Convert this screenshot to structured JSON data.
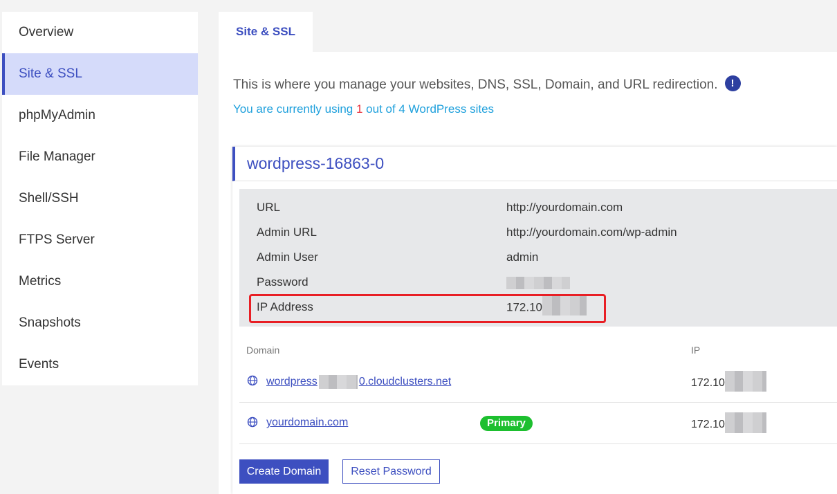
{
  "sidebar": {
    "items": [
      {
        "label": "Overview"
      },
      {
        "label": "Site & SSL"
      },
      {
        "label": "phpMyAdmin"
      },
      {
        "label": "File Manager"
      },
      {
        "label": "Shell/SSH"
      },
      {
        "label": "FTPS Server"
      },
      {
        "label": "Metrics"
      },
      {
        "label": "Snapshots"
      },
      {
        "label": "Events"
      }
    ],
    "active_index": 1
  },
  "tabs": [
    {
      "label": "Site & SSL"
    }
  ],
  "intro": {
    "description": "This is where you manage your websites, DNS, SSL, Domain, and URL redirection.",
    "info_icon": "!",
    "usage_prefix": "You are currently using ",
    "usage_count": "1",
    "usage_suffix": " out of 4 WordPress sites"
  },
  "site": {
    "name": "wordpress-16863-0",
    "details": [
      {
        "key": "URL",
        "value": "http://yourdomain.com"
      },
      {
        "key": "Admin URL",
        "value": "http://yourdomain.com/wp-admin"
      },
      {
        "key": "Admin User",
        "value": "admin"
      },
      {
        "key": "Password",
        "value": ""
      },
      {
        "key": "IP Address",
        "value": "172.10"
      }
    ]
  },
  "domains": {
    "headers": {
      "domain": "Domain",
      "ip": "IP"
    },
    "rows": [
      {
        "domain_start": "wordpress",
        "domain_end": "0.cloudclusters.net",
        "badge": "",
        "ip": "172.10"
      },
      {
        "domain_start": "yourdomain.com",
        "domain_end": "",
        "badge": "Primary",
        "ip": "172.10"
      }
    ]
  },
  "actions": {
    "create_domain": "Create Domain",
    "reset_password": "Reset Password"
  },
  "colors": {
    "accent": "#3d4fc0",
    "active_bg": "#d5dbfa",
    "usage_text": "#1ea0dc",
    "usage_count": "#e8303a",
    "primary_badge": "#1dbf2f",
    "highlight_border": "#e81f25"
  }
}
